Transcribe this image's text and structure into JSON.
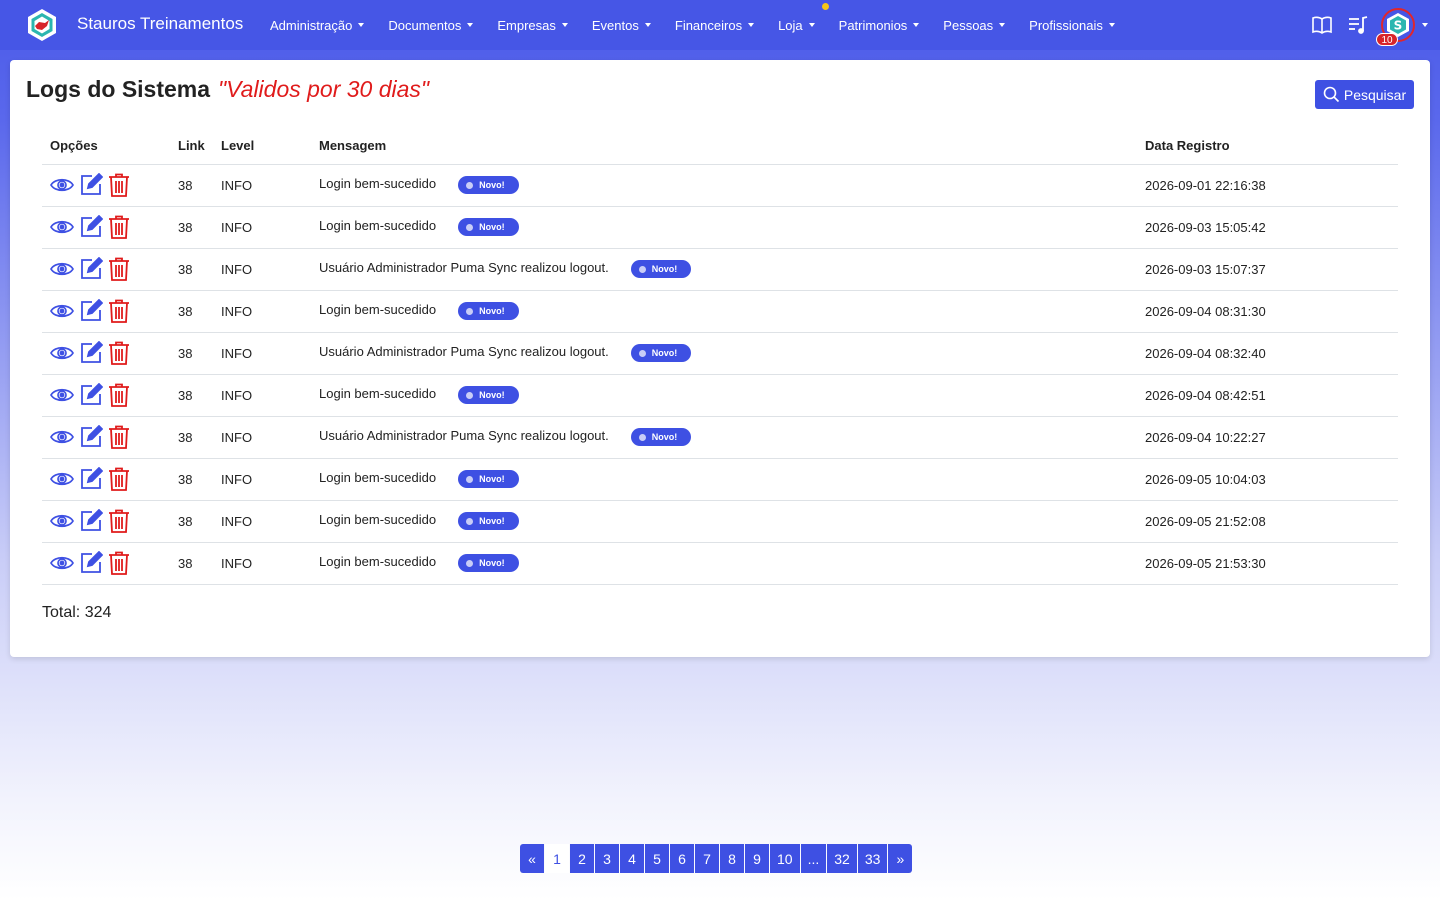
{
  "navbar": {
    "brand": "Stauros Treinamentos",
    "menu": [
      {
        "label": "Administração"
      },
      {
        "label": "Documentos"
      },
      {
        "label": "Empresas"
      },
      {
        "label": "Eventos"
      },
      {
        "label": "Financeiros"
      },
      {
        "label": "Loja",
        "has_dot": true
      },
      {
        "label": "Patrimonios"
      },
      {
        "label": "Pessoas"
      },
      {
        "label": "Profissionais"
      }
    ],
    "icons": [
      "book-icon",
      "playlist-icon"
    ],
    "notification_count": "10"
  },
  "page": {
    "title": "Logs do Sistema",
    "subtitle": "\"Validos por 30 dias\"",
    "search_label": "Pesquisar"
  },
  "table": {
    "headers": {
      "options": "Opções",
      "link": "Link",
      "level": "Level",
      "message": "Mensagem",
      "date": "Data Registro"
    },
    "badge_label": "Novo!",
    "rows": [
      {
        "link": "38",
        "level": "INFO",
        "message": "Login bem-sucedido",
        "date": "2026-09-01 22:16:38"
      },
      {
        "link": "38",
        "level": "INFO",
        "message": "Login bem-sucedido",
        "date": "2026-09-03 15:05:42"
      },
      {
        "link": "38",
        "level": "INFO",
        "message": "Usuário Administrador Puma Sync realizou logout.",
        "date": "2026-09-03 15:07:37"
      },
      {
        "link": "38",
        "level": "INFO",
        "message": "Login bem-sucedido",
        "date": "2026-09-04 08:31:30"
      },
      {
        "link": "38",
        "level": "INFO",
        "message": "Usuário Administrador Puma Sync realizou logout.",
        "date": "2026-09-04 08:32:40"
      },
      {
        "link": "38",
        "level": "INFO",
        "message": "Login bem-sucedido",
        "date": "2026-09-04 08:42:51"
      },
      {
        "link": "38",
        "level": "INFO",
        "message": "Usuário Administrador Puma Sync realizou logout.",
        "date": "2026-09-04 10:22:27"
      },
      {
        "link": "38",
        "level": "INFO",
        "message": "Login bem-sucedido",
        "date": "2026-09-05 10:04:03"
      },
      {
        "link": "38",
        "level": "INFO",
        "message": "Login bem-sucedido",
        "date": "2026-09-05 21:52:08"
      },
      {
        "link": "38",
        "level": "INFO",
        "message": "Login bem-sucedido",
        "date": "2026-09-05 21:53:30"
      }
    ],
    "total": "Total: 324"
  },
  "pagination": {
    "pages": [
      "«",
      "1",
      "2",
      "3",
      "4",
      "5",
      "6",
      "7",
      "8",
      "9",
      "10",
      "...",
      "32",
      "33",
      "»"
    ],
    "active": "1"
  },
  "colors": {
    "primary": "#3e50e3",
    "navbar": "#4656e6",
    "danger": "#e01b1b"
  }
}
